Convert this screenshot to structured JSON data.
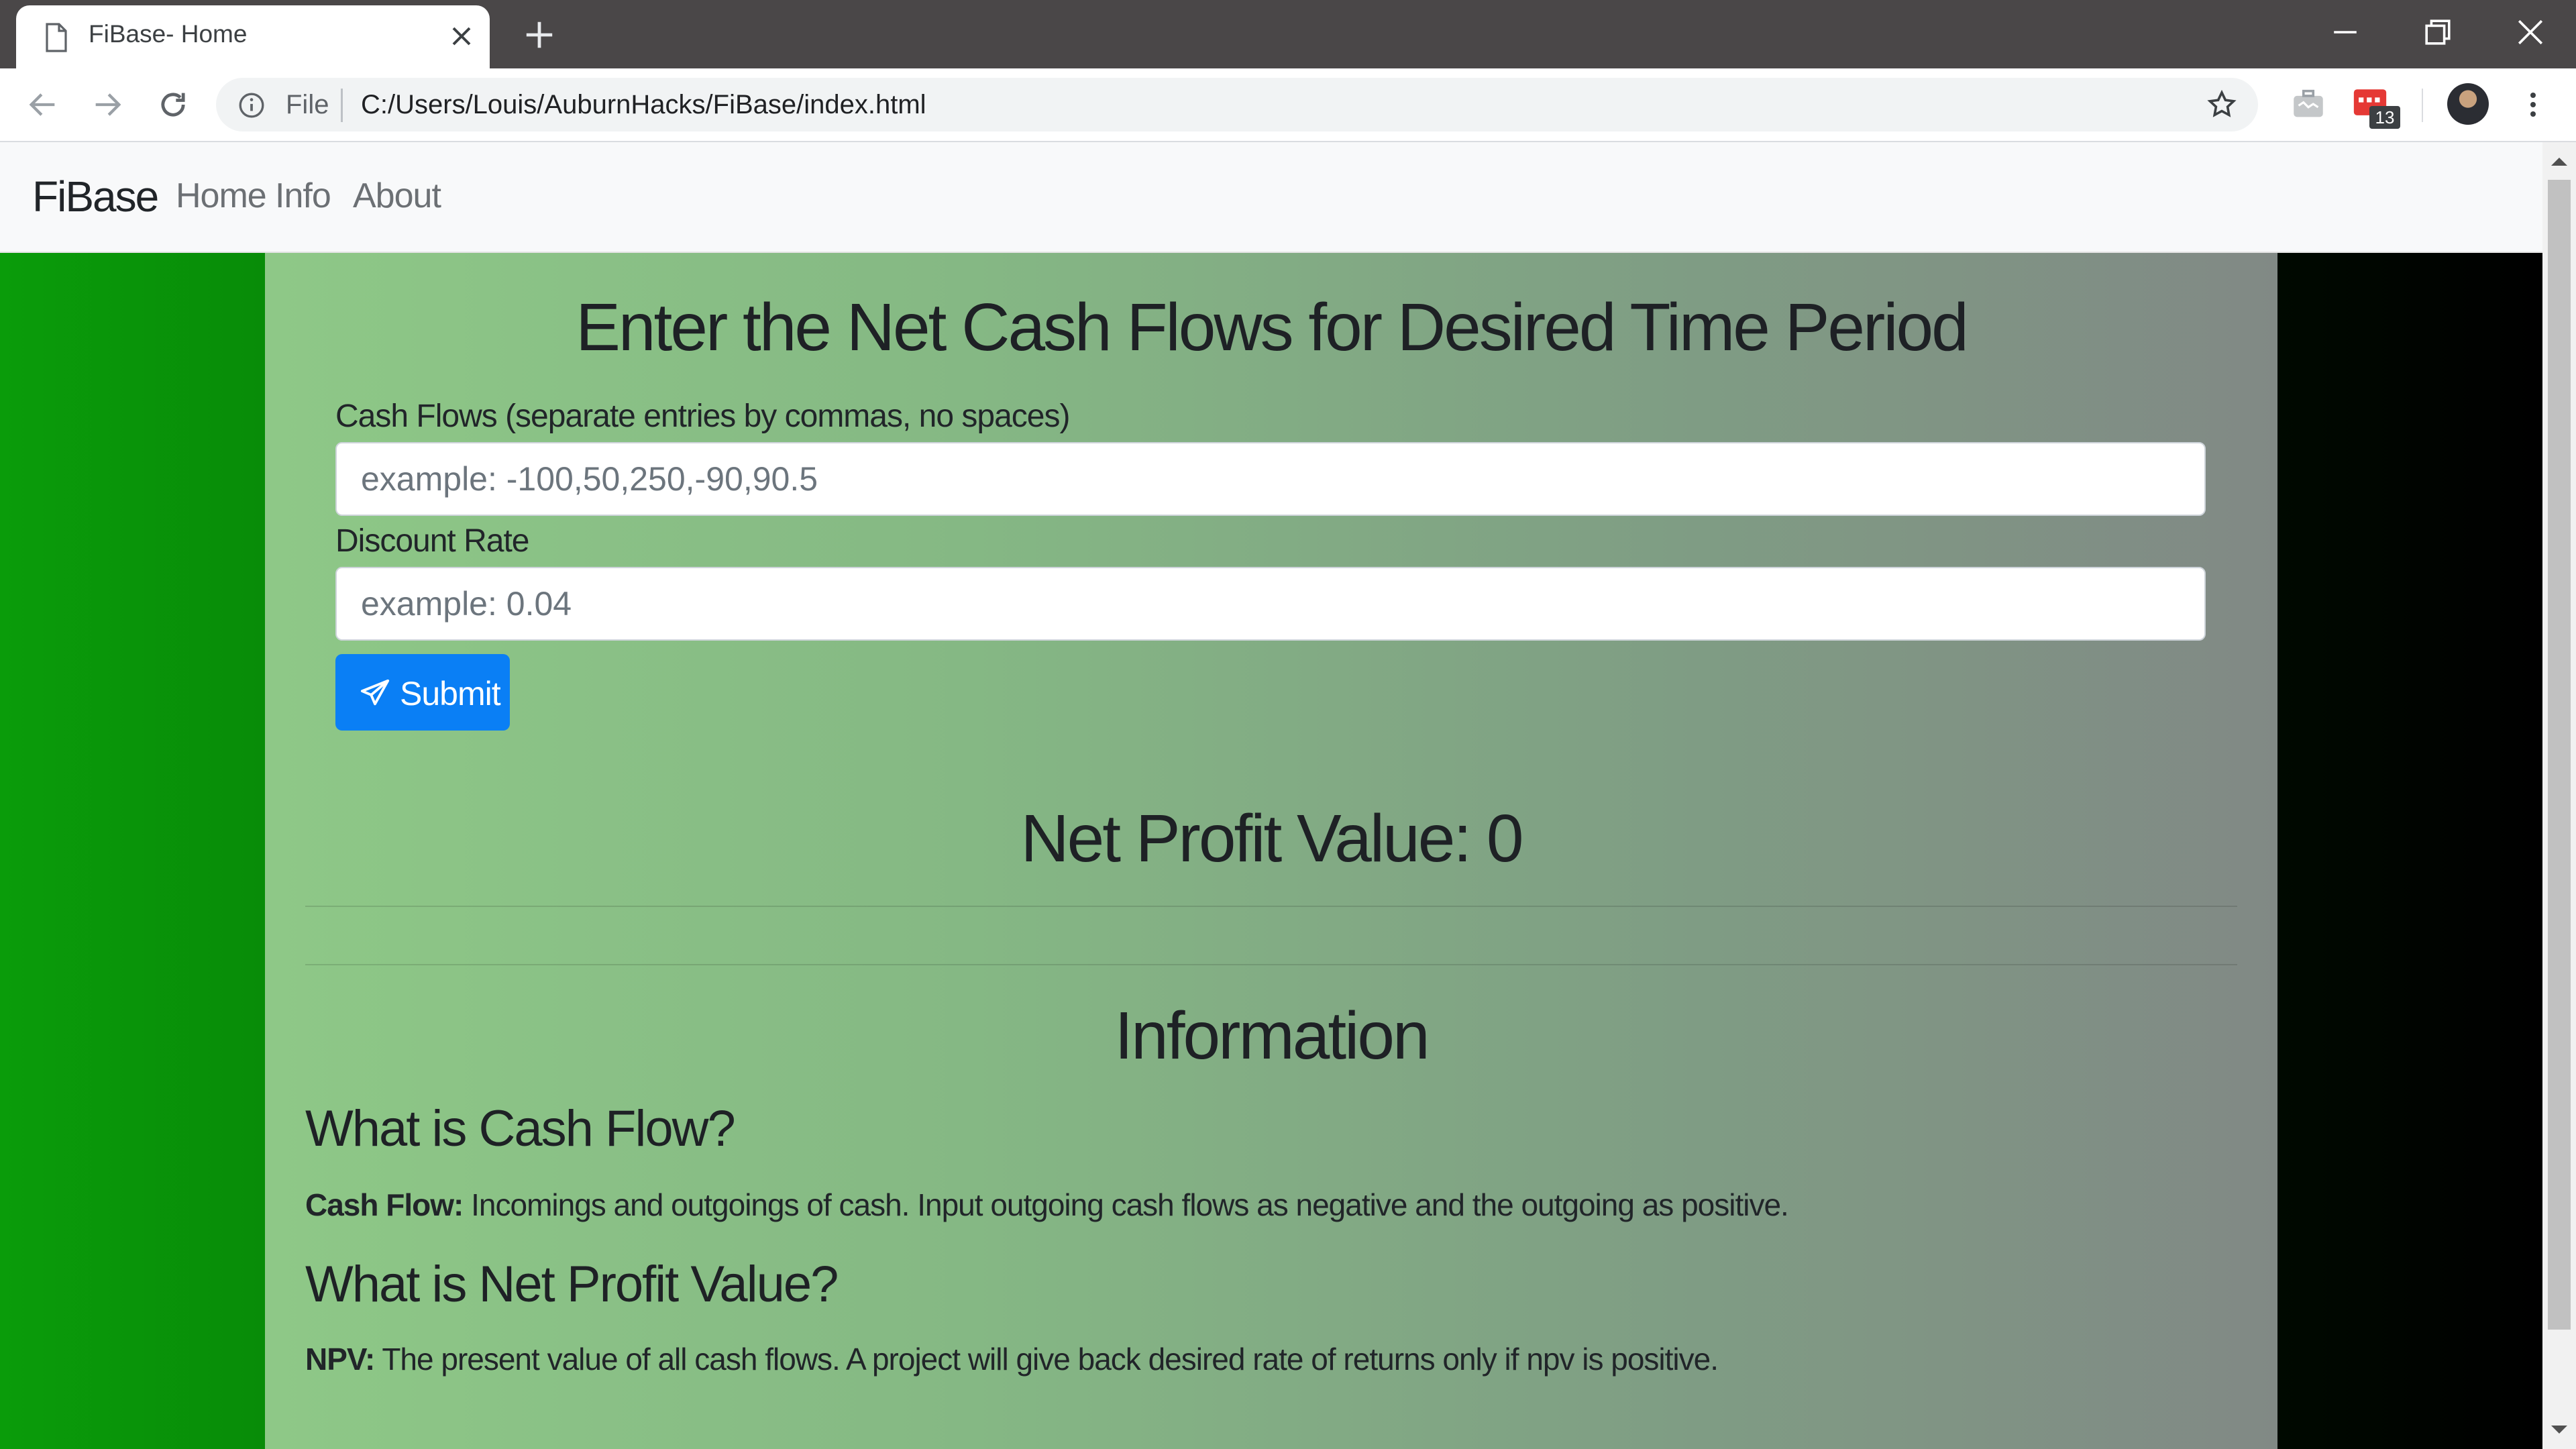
{
  "browser": {
    "tab_title": "FiBase- Home",
    "omnibox_scheme": "File",
    "url": "C:/Users/Louis/AuburnHacks/FiBase/index.html",
    "extension_badge": "13"
  },
  "navbar": {
    "brand": "FiBase",
    "links": [
      "Home",
      "Info",
      "About"
    ]
  },
  "form": {
    "title": "Enter the Net Cash Flows for Desired Time Period",
    "cash_flows_label": "Cash Flows (separate entries by commas, no spaces)",
    "cash_flows_placeholder": "example: -100,50,250,-90,90.5",
    "discount_label": "Discount Rate",
    "discount_placeholder": "example: 0.04",
    "submit_label": "Submit"
  },
  "result": {
    "npv_text": "Net Profit Value: 0"
  },
  "information": {
    "title": "Information",
    "q1": "What is Cash Flow?",
    "q1_term": "Cash Flow:",
    "q1_text": " Incomings and outgoings of cash. Input outgoing cash flows as negative and the outgoing as positive.",
    "q2": "What is Net Profit Value?",
    "q2_term": "NPV:",
    "q2_text": " The present value of all cash flows. A project will give back desired rate of returns only if npv is positive."
  },
  "colors": {
    "submit_bg": "#0a7ff5",
    "left_gutter": "#0a9c0a",
    "right_gutter": "#000000"
  }
}
